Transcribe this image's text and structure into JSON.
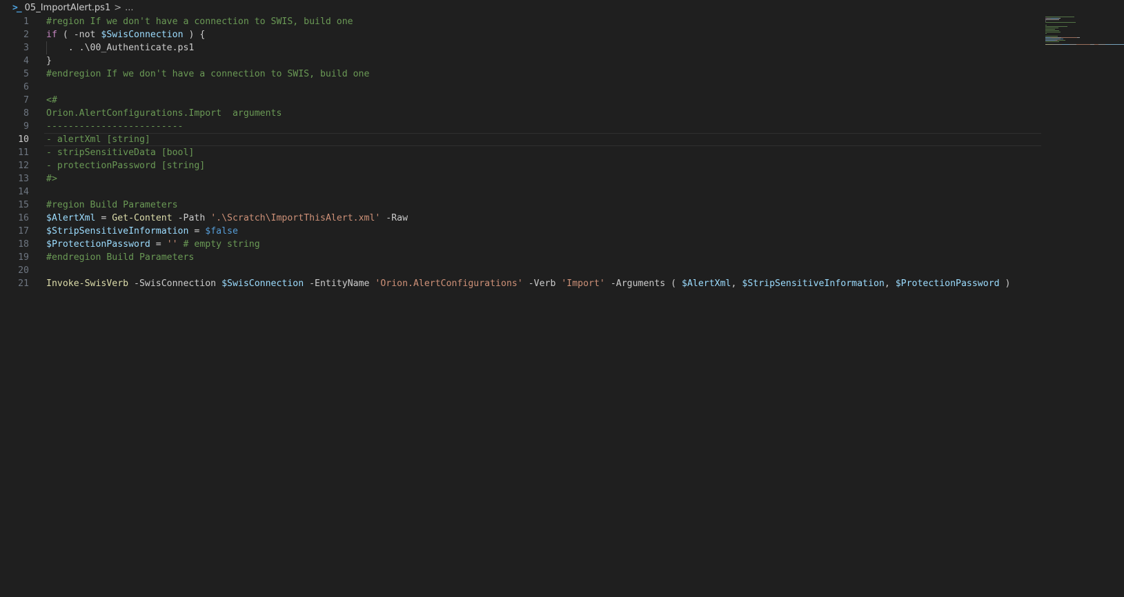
{
  "breadcrumb": {
    "file": "05_ImportAlert.ps1",
    "separator": ">",
    "more": "..."
  },
  "current_line": 10,
  "lines": [
    {
      "n": "1",
      "tokens": [
        {
          "t": "#region If we don't have a connection to SWIS, build one",
          "c": "comment"
        }
      ]
    },
    {
      "n": "2",
      "tokens": [
        {
          "t": "if",
          "c": "keyword"
        },
        {
          "t": " ( -not ",
          "c": "plain"
        },
        {
          "t": "$SwisConnection",
          "c": "var"
        },
        {
          "t": " ) {",
          "c": "plain"
        }
      ]
    },
    {
      "n": "3",
      "tokens": [
        {
          "t": "    . .\\00_Authenticate.ps1",
          "c": "plain"
        }
      ]
    },
    {
      "n": "4",
      "tokens": [
        {
          "t": "}",
          "c": "plain"
        }
      ]
    },
    {
      "n": "5",
      "tokens": [
        {
          "t": "#endregion If we don't have a connection to SWIS, build one",
          "c": "comment"
        }
      ]
    },
    {
      "n": "6",
      "tokens": []
    },
    {
      "n": "7",
      "tokens": [
        {
          "t": "<#",
          "c": "comment"
        }
      ]
    },
    {
      "n": "8",
      "tokens": [
        {
          "t": "Orion.AlertConfigurations.Import  arguments",
          "c": "comment"
        }
      ]
    },
    {
      "n": "9",
      "tokens": [
        {
          "t": "-------------------------",
          "c": "comment"
        }
      ]
    },
    {
      "n": "10",
      "tokens": [
        {
          "t": "- alertXml [string]",
          "c": "comment"
        }
      ]
    },
    {
      "n": "11",
      "tokens": [
        {
          "t": "- stripSensitiveData [bool]",
          "c": "comment"
        }
      ]
    },
    {
      "n": "12",
      "tokens": [
        {
          "t": "- protectionPassword [string]",
          "c": "comment"
        }
      ]
    },
    {
      "n": "13",
      "tokens": [
        {
          "t": "#>",
          "c": "comment"
        }
      ]
    },
    {
      "n": "14",
      "tokens": []
    },
    {
      "n": "15",
      "tokens": [
        {
          "t": "#region Build Parameters",
          "c": "comment"
        }
      ]
    },
    {
      "n": "16",
      "tokens": [
        {
          "t": "$AlertXml",
          "c": "var"
        },
        {
          "t": " = ",
          "c": "plain"
        },
        {
          "t": "Get-Content",
          "c": "func"
        },
        {
          "t": " -Path ",
          "c": "plain"
        },
        {
          "t": "'.\\Scratch\\ImportThisAlert.xml'",
          "c": "string"
        },
        {
          "t": " -Raw",
          "c": "plain"
        }
      ]
    },
    {
      "n": "17",
      "tokens": [
        {
          "t": "$StripSensitiveInformation",
          "c": "var"
        },
        {
          "t": " = ",
          "c": "plain"
        },
        {
          "t": "$false",
          "c": "const"
        }
      ]
    },
    {
      "n": "18",
      "tokens": [
        {
          "t": "$ProtectionPassword",
          "c": "var"
        },
        {
          "t": " = ",
          "c": "plain"
        },
        {
          "t": "''",
          "c": "string"
        },
        {
          "t": " # empty string",
          "c": "comment"
        }
      ]
    },
    {
      "n": "19",
      "tokens": [
        {
          "t": "#endregion Build Parameters",
          "c": "comment"
        }
      ]
    },
    {
      "n": "20",
      "tokens": []
    },
    {
      "n": "21",
      "tokens": [
        {
          "t": "Invoke-SwisVerb",
          "c": "func"
        },
        {
          "t": " -SwisConnection ",
          "c": "plain"
        },
        {
          "t": "$SwisConnection",
          "c": "var"
        },
        {
          "t": " -EntityName ",
          "c": "plain"
        },
        {
          "t": "'Orion.AlertConfigurations'",
          "c": "string"
        },
        {
          "t": " -Verb ",
          "c": "plain"
        },
        {
          "t": "'Import'",
          "c": "string"
        },
        {
          "t": " -Arguments ( ",
          "c": "plain"
        },
        {
          "t": "$AlertXml",
          "c": "var"
        },
        {
          "t": ", ",
          "c": "plain"
        },
        {
          "t": "$StripSensitiveInformation",
          "c": "var"
        },
        {
          "t": ", ",
          "c": "plain"
        },
        {
          "t": "$ProtectionPassword",
          "c": "var"
        },
        {
          "t": " )",
          "c": "plain"
        }
      ]
    }
  ],
  "colors": {
    "background": "#1f1f1f",
    "comment": "#6a9955",
    "keyword": "#c586c0",
    "variable": "#9cdcfe",
    "function": "#dcdcaa",
    "string": "#ce9178",
    "constant": "#569cd6",
    "plain": "#cccccc",
    "line_number": "#6e7681"
  },
  "icons": {
    "file_type": "powershell-icon",
    "breadcrumb_chevron": "chevron-right-icon"
  }
}
